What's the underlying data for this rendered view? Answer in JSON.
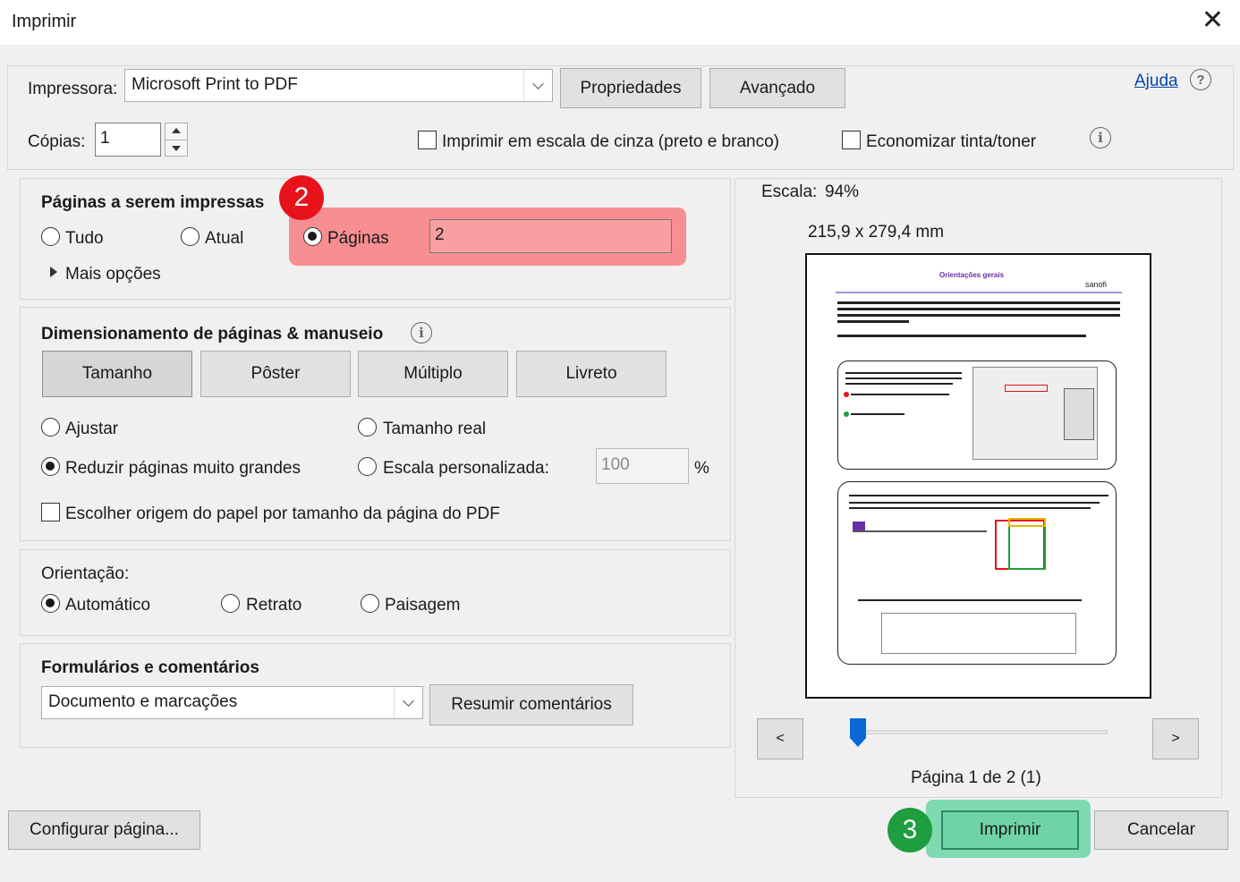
{
  "window": {
    "title": "Imprimir",
    "close_glyph": "✕"
  },
  "printer": {
    "label": "Impressora:",
    "selected": "Microsoft Print to PDF",
    "properties_label": "Propriedades",
    "advanced_label": "Avançado",
    "help_label": "Ajuda",
    "help_icon": "?"
  },
  "copies": {
    "label": "Cópias:",
    "value": "1"
  },
  "options": {
    "grayscale_label": "Imprimir em escala de cinza (preto e branco)",
    "grayscale_checked": false,
    "save_ink_label": "Economizar tinta/toner",
    "save_ink_checked": false,
    "info_icon": "i"
  },
  "pages": {
    "heading": "Páginas a serem impressas",
    "all_label": "Tudo",
    "current_label": "Atual",
    "pages_label": "Páginas",
    "pages_value": "2",
    "selected": "pages",
    "more_options_label": "Mais opções"
  },
  "sizing": {
    "heading": "Dimensionamento de páginas & manuseio",
    "info_icon": "i",
    "tabs": [
      "Tamanho",
      "Pôster",
      "Múltiplo",
      "Livreto"
    ],
    "fit_label": "Ajustar",
    "actual_size_label": "Tamanho real",
    "shrink_label": "Reduzir páginas muito grandes",
    "custom_scale_label": "Escala personalizada:",
    "custom_scale_value": "100",
    "percent_sign": "%",
    "selected": "shrink",
    "paper_source_label": "Escolher origem do papel por tamanho da página do PDF",
    "paper_source_checked": false
  },
  "orientation": {
    "heading": "Orientação:",
    "auto_label": "Automático",
    "portrait_label": "Retrato",
    "landscape_label": "Paisagem",
    "selected": "auto"
  },
  "forms": {
    "heading": "Formulários e comentários",
    "selected": "Documento e marcações",
    "summarize_label": "Resumir comentários"
  },
  "preview": {
    "scale_label": "Escala:",
    "scale_value": "94%",
    "dimensions": "215,9 x 279,4 mm",
    "doc_title": "Orientações gerais",
    "doc_brand": "sanofi",
    "prev_label": "<",
    "next_label": ">",
    "page_label": "Página 1 de 2 (1)"
  },
  "footer": {
    "page_setup_label": "Configurar página...",
    "print_label": "Imprimir",
    "cancel_label": "Cancelar"
  },
  "annotations": [
    {
      "number": "2",
      "color": "#e8121b"
    },
    {
      "number": "3",
      "color": "#1e9e3f"
    }
  ],
  "colors": {
    "highlight_red": "#f78f92",
    "highlight_green": "#7fd9b1",
    "link_blue": "#0645ad",
    "print_button": "#6fd3a6"
  }
}
